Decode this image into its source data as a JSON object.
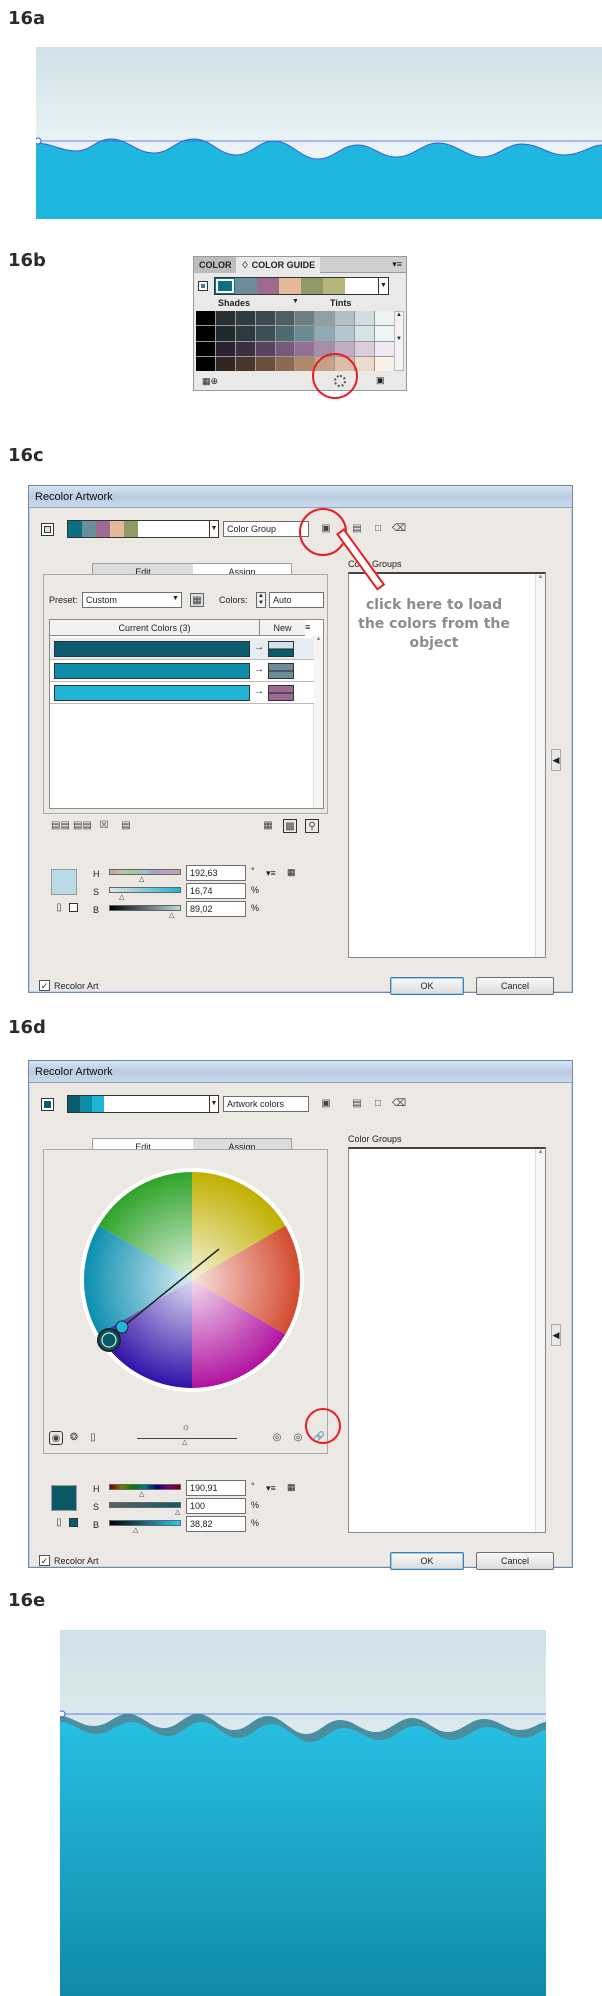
{
  "steps": {
    "a": "16a",
    "b": "16b",
    "c": "16c",
    "d": "16d",
    "e": "16e"
  },
  "colors": {
    "water": "#1fb7de",
    "water_dark": "#1593b6",
    "sky_top": "#cfe2e8",
    "sky_bottom": "#ffffff",
    "annotation_red": "#e41e25",
    "dialog_bg": "#ece9e4"
  },
  "color_guide_panel": {
    "tab_color": "COLOR",
    "tab_color_guide": "♢ COLOR GUIDE",
    "menu_icon": "menu-icon",
    "shades_label": "Shades",
    "tints_label": "Tints",
    "strip_colors": [
      "#0f6f82",
      "#6b8c99",
      "#9c6b8f",
      "#e6b89a",
      "#8f9a66",
      "#b5b579"
    ],
    "grid_colors": [
      [
        "#000000",
        "#2b3133",
        "#2f3d42",
        "#3c4b50",
        "#4e5f63",
        "#6e7f82",
        "#8ea0a3",
        "#b1c0c2",
        "#d3dcde",
        "#eef2f3"
      ],
      [
        "#000000",
        "#1f2a2d",
        "#2a3a40",
        "#3b5057",
        "#4c6a72",
        "#6a8b94",
        "#8eaab2",
        "#b2c8ce",
        "#d4e3e7",
        "#eef5f7"
      ],
      [
        "#000000",
        "#2a2230",
        "#3c2f44",
        "#5a4360",
        "#755a7a",
        "#936f95",
        "#a98eac",
        "#c2aec4",
        "#dbcddc",
        "#f1e9f1"
      ],
      [
        "#000000",
        "#332620",
        "#4a372c",
        "#6b4f3e",
        "#8c6a52",
        "#b08868",
        "#c9a286",
        "#dcbea7",
        "#ecdacb",
        "#f8f0e9"
      ]
    ],
    "bottom_left_icon": "swatch-grid-icon",
    "recolor_icon": "recolor-artwork-icon",
    "edit_icon": "edit-colors-icon"
  },
  "dialog_c": {
    "title": "Recolor Artwork",
    "group_name": "Color Group",
    "color_groups_label": "Color Groups",
    "strip_colors": [
      "#0a6f82",
      "#6b8c99",
      "#9c6b8f",
      "#e6b89a",
      "#8f9a66"
    ],
    "tabs": [
      "Edit",
      "Assign"
    ],
    "preset_label": "Preset:",
    "preset_value": "Custom",
    "colors_label": "Colors:",
    "colors_value": "Auto",
    "table_header_current": "Current Colors (3)",
    "table_header_new": "New",
    "rows": [
      {
        "current": "#0a5c6e",
        "new_top": "#cfe3ea",
        "new_bottom": "#0a5c6e"
      },
      {
        "current": "#0f8ea9",
        "new_top": "#6f8d99",
        "new_bottom": "#6f8d99"
      },
      {
        "current": "#21b3d6",
        "new_top": "#9b6b93",
        "new_bottom": "#9b6b93"
      }
    ],
    "swatch_color": "#b9dbe3",
    "h_label": "H",
    "s_label": "S",
    "b_label": "B",
    "h_value": "192,63",
    "s_value": "16,74",
    "b_value": "89,02",
    "deg_unit": "°",
    "pct_unit": "%",
    "recolor_art_label": "Recolor Art",
    "ok_label": "OK",
    "cancel_label": "Cancel",
    "annotation": "click here to load the colors from the object"
  },
  "dialog_d": {
    "title": "Recolor Artwork",
    "group_name": "Artwork colors",
    "color_groups_label": "Color Groups",
    "strip_colors": [
      "#0a5c6e",
      "#0f8ea9",
      "#21b3d6"
    ],
    "tabs": [
      "Edit",
      "Assign"
    ],
    "swatch_color": "#0a5766",
    "h_label": "H",
    "s_label": "S",
    "b_label": "B",
    "h_value": "190,91",
    "s_value": "100",
    "b_value": "38,82",
    "deg_unit": "°",
    "pct_unit": "%",
    "recolor_art_label": "Recolor Art",
    "ok_label": "OK",
    "cancel_label": "Cancel"
  }
}
